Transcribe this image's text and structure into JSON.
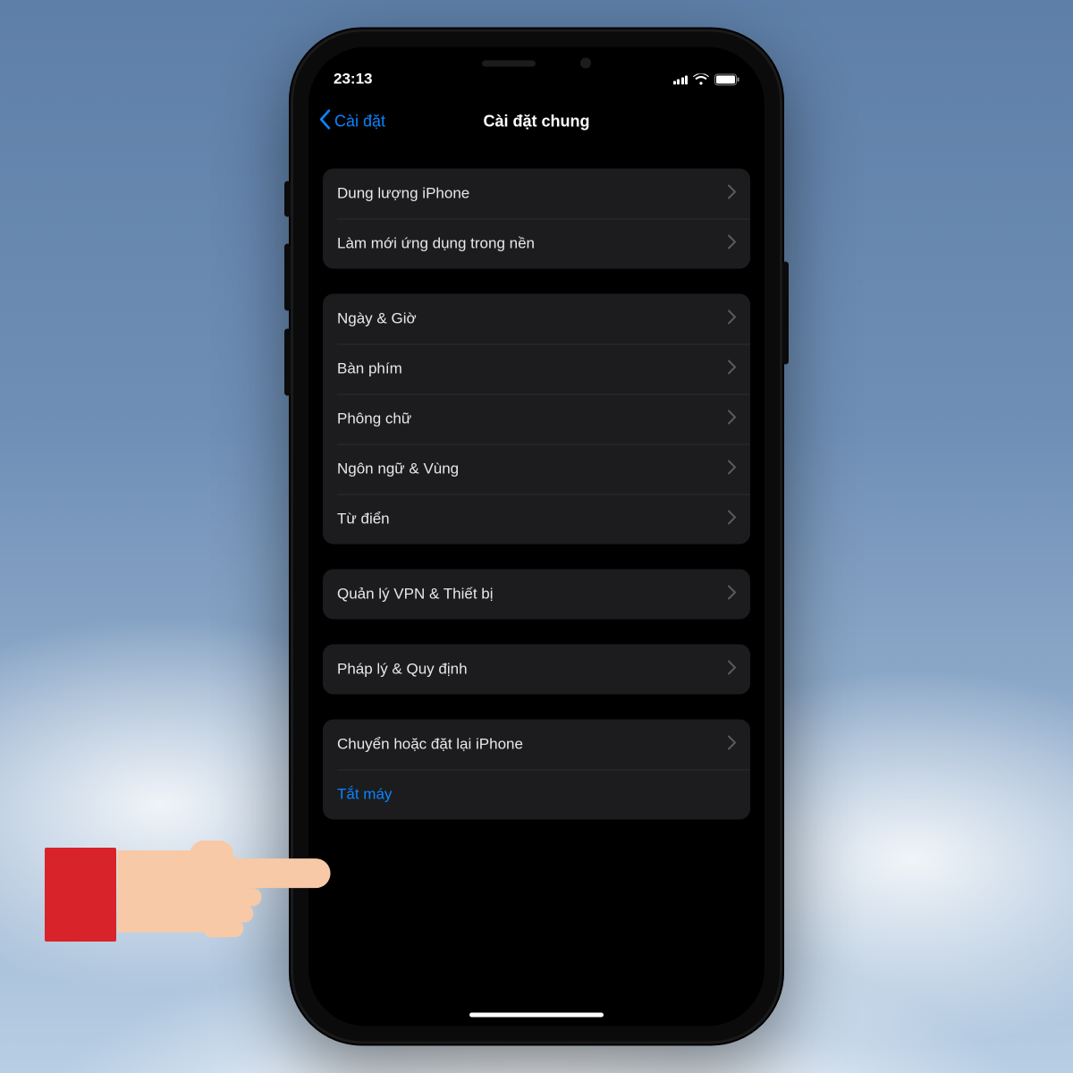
{
  "colors": {
    "accent": "#0a84ff",
    "cell": "#1c1c1e",
    "bg": "#000000"
  },
  "status": {
    "time": "23:13"
  },
  "nav": {
    "back": "Cài đặt",
    "title": "Cài đặt chung"
  },
  "groups": [
    {
      "rows": [
        {
          "label": "Dung lượng iPhone",
          "chevron": true
        },
        {
          "label": "Làm mới ứng dụng trong nền",
          "chevron": true
        }
      ]
    },
    {
      "rows": [
        {
          "label": "Ngày & Giờ",
          "chevron": true
        },
        {
          "label": "Bàn phím",
          "chevron": true
        },
        {
          "label": "Phông chữ",
          "chevron": true
        },
        {
          "label": "Ngôn ngữ & Vùng",
          "chevron": true
        },
        {
          "label": "Từ điển",
          "chevron": true
        }
      ]
    },
    {
      "rows": [
        {
          "label": "Quản lý VPN & Thiết bị",
          "chevron": true
        }
      ]
    },
    {
      "rows": [
        {
          "label": "Pháp lý & Quy định",
          "chevron": true
        }
      ]
    },
    {
      "rows": [
        {
          "label": "Chuyển hoặc đặt lại iPhone",
          "chevron": true
        },
        {
          "label": "Tắt máy",
          "chevron": false,
          "blue": true
        }
      ]
    }
  ],
  "pointer_row_label": "Chuyển hoặc đặt lại iPhone"
}
